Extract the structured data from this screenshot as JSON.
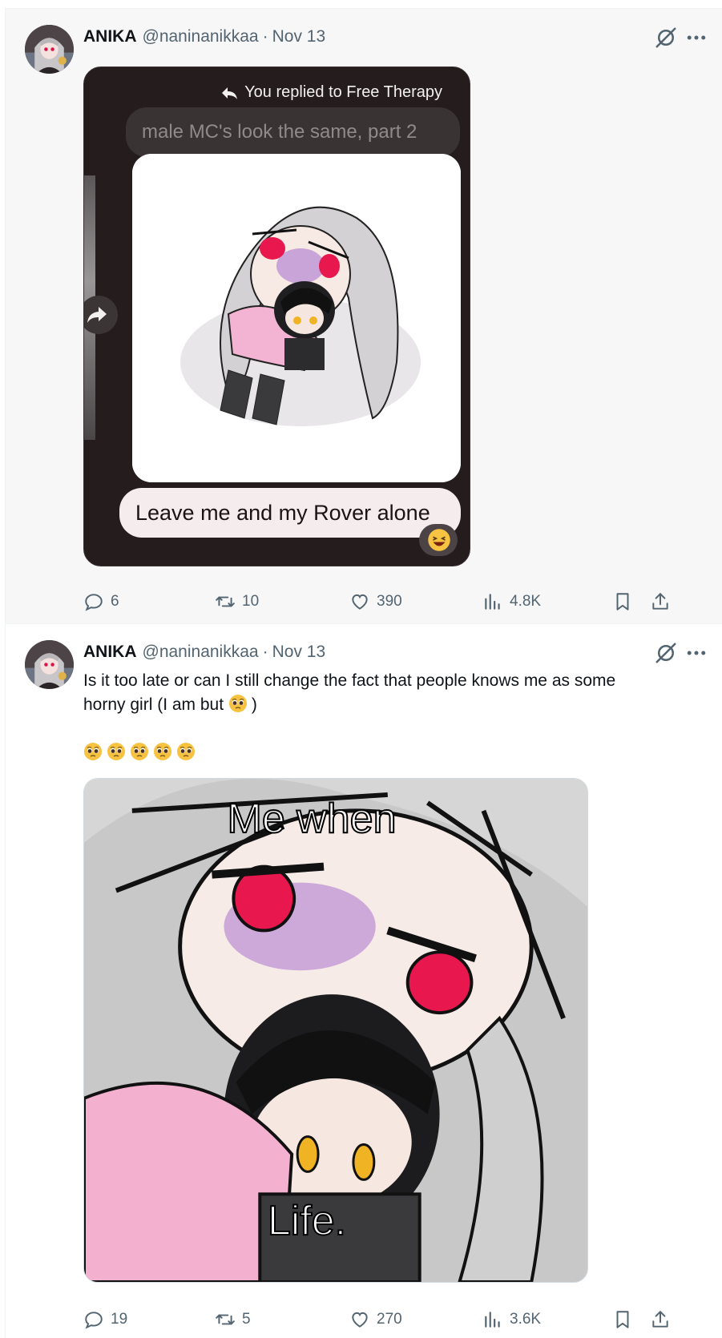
{
  "tweets": [
    {
      "author": {
        "name": "ANIKA",
        "handle": "@naninanikkaa",
        "separator": "·",
        "date": "Nov 13"
      },
      "media": {
        "reply_note": "You replied to Free Therapy",
        "quoted_message": "male MC's look the same, part 2",
        "message": "Leave me and my Rover alone",
        "reaction_icon": "laughing-emoji-icon"
      },
      "stats": {
        "replies": "6",
        "retweets": "10",
        "likes": "390",
        "views": "4.8K"
      }
    },
    {
      "author": {
        "name": "ANIKA",
        "handle": "@naninanikkaa",
        "separator": "·",
        "date": "Nov 13"
      },
      "text": {
        "line1": "Is it too late or can I still change the fact that people knows me as some",
        "line2": "horny girl (I am but ",
        "line2_end": ")"
      },
      "emoji_row_icon": "pleading-face-emoji-icon",
      "media": {
        "caption_top": "Me when",
        "caption_bottom": "Life."
      },
      "stats": {
        "replies": "19",
        "retweets": "5",
        "likes": "270",
        "views": "3.6K"
      }
    }
  ],
  "colors": {
    "secondary_text": "#536471",
    "primary_text": "#0f1419",
    "dm_background": "#251c1d"
  }
}
